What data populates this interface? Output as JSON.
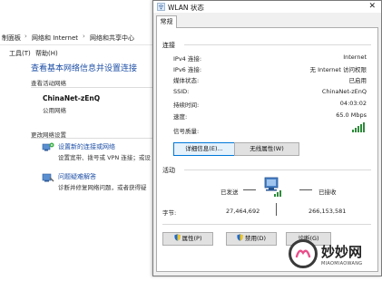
{
  "background_window": {
    "breadcrumb": [
      "制面板",
      "网络和 Internet",
      "网络和共享中心"
    ],
    "menu": [
      "工具(T)",
      "帮助(H)"
    ],
    "page_title": "查看基本网络信息并设置连接",
    "active_networks_label": "查看活动网络",
    "network_name": "ChinaNet-zEnQ",
    "network_type": "公用网络",
    "change_settings_label": "更改网络设置",
    "setup_link": "设置新的连接或网络",
    "setup_desc": "设置宽带、拨号或 VPN 连接；或设",
    "troubleshoot_link": "问题疑难解答",
    "troubleshoot_desc": "诊断并修复网络问题，或者获得疑"
  },
  "dialog": {
    "title": "WLAN 状态",
    "tab": "常规",
    "connection": {
      "label": "连接",
      "rows": [
        {
          "label": "IPv4 连接:",
          "value": "Internet"
        },
        {
          "label": "IPv6 连接:",
          "value": "无 Internet 访问权限"
        },
        {
          "label": "媒体状态:",
          "value": "已启用"
        },
        {
          "label": "SSID:",
          "value": "ChinaNet-zEnQ"
        },
        {
          "label": "持续时间:",
          "value": "04:03:02"
        },
        {
          "label": "速度:",
          "value": "65.0 Mbps"
        }
      ],
      "signal_label": "信号质量:",
      "signal_bars_filled": 5,
      "details_button": "详细信息(E)...",
      "wireless_props_button": "无线属性(W)"
    },
    "activity": {
      "label": "活动",
      "sent_label": "已发送",
      "received_label": "已接收",
      "bytes_label": "字节:",
      "bytes_sent": "27,464,692",
      "bytes_received": "266,153,581"
    },
    "buttons": {
      "properties": "属性(P)",
      "disable": "禁用(D)",
      "diagnose": "诊断(G)"
    }
  },
  "watermark": {
    "text": "妙妙网",
    "sub": "MIAOMIAOWANG"
  },
  "colors": {
    "link": "#1e4fa6",
    "signal": "#2e8b3a",
    "dialog_bg": "#f0f0f0"
  }
}
